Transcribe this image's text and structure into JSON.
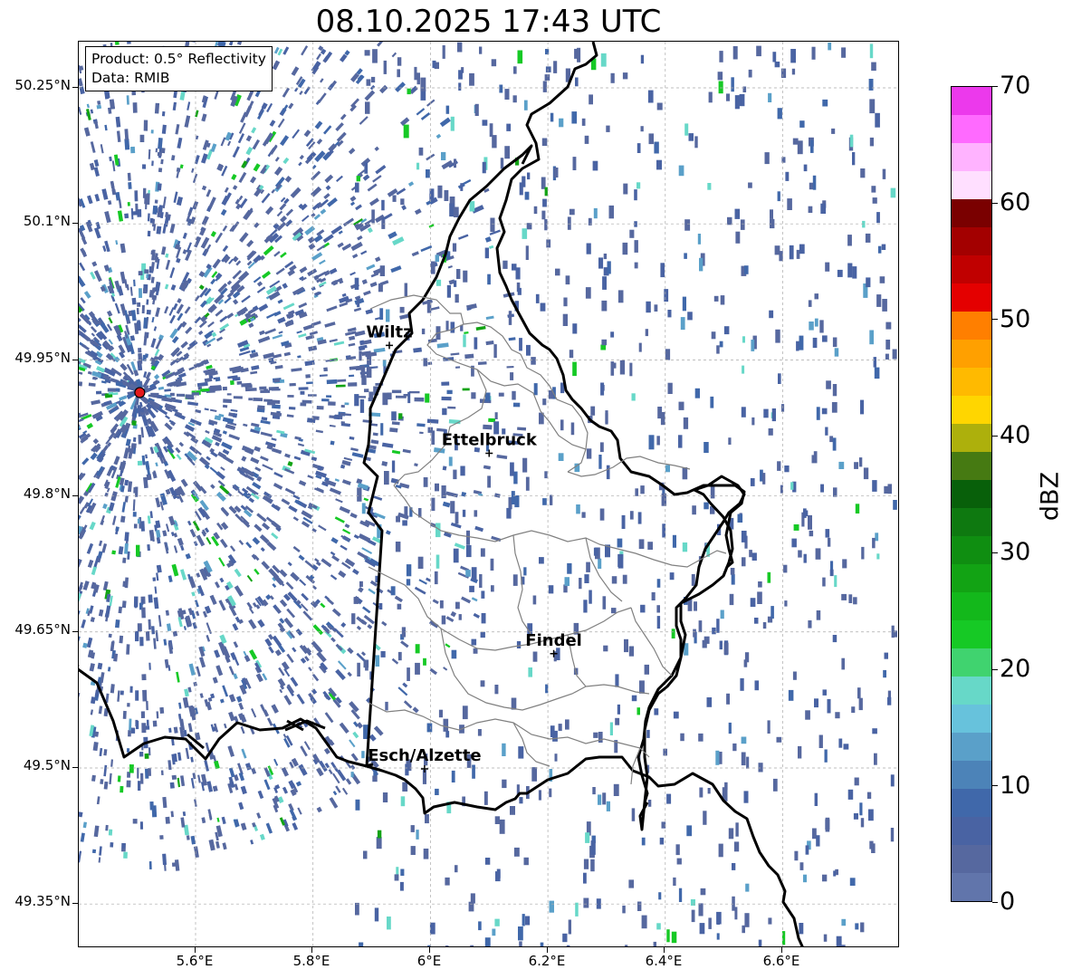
{
  "title": "08.10.2025 17:43 UTC",
  "info": {
    "product": "Product: 0.5° Reflectivity",
    "source": "Data: RMIB"
  },
  "axes": {
    "lon_ticks": [
      "5.6°E",
      "5.8°E",
      "6°E",
      "6.2°E",
      "6.4°E",
      "6.6°E"
    ],
    "lat_ticks": [
      "50.25°N",
      "50.1°N",
      "49.95°N",
      "49.8°N",
      "49.65°N",
      "49.5°N",
      "49.35°N"
    ],
    "gridlines": true
  },
  "cities": [
    {
      "name": "Wiltz",
      "lon": 5.93,
      "lat": 49.966
    },
    {
      "name": "Ettelbruck",
      "lon": 6.1,
      "lat": 49.847
    },
    {
      "name": "Findel",
      "lon": 6.21,
      "lat": 49.626
    },
    {
      "name": "Esch/Alzette",
      "lon": 5.99,
      "lat": 49.499
    }
  ],
  "radar_site": {
    "lon": 5.505,
    "lat": 49.914,
    "color": "#e41a1c"
  },
  "colorbar": {
    "label": "dBZ",
    "ticks": [
      "0",
      "10",
      "20",
      "30",
      "40",
      "50",
      "60",
      "70"
    ],
    "colors": [
      "#6175ab",
      "#56689f",
      "#4963a3",
      "#4068aa",
      "#4c83b8",
      "#5aa0c9",
      "#67c2dc",
      "#67d8c8",
      "#40d36f",
      "#16c925",
      "#13b81b",
      "#12a314",
      "#0f8e11",
      "#0e7910",
      "#08600a",
      "#467a12",
      "#adb00c",
      "#ffd600",
      "#ffba00",
      "#ffa000",
      "#ff7f00",
      "#e40000",
      "#c00000",
      "#a30000",
      "#7a0000",
      "#ffdfff",
      "#ffb3ff",
      "#ff6aff",
      "#ec39ec"
    ]
  }
}
